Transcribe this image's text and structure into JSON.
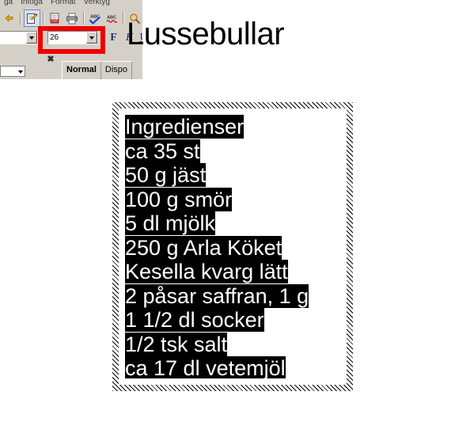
{
  "app": {
    "menu": {
      "items": [
        {
          "label": "ga"
        },
        {
          "label": "Infoga"
        },
        {
          "label": "Format"
        },
        {
          "label": "Verktyg"
        }
      ]
    },
    "toolbar_main": {
      "buttons": [
        {
          "name": "open-recent-icon",
          "label": "◆"
        },
        {
          "name": "edit-mode-icon",
          "label": "✎"
        },
        {
          "name": "export-pdf-icon",
          "label": "PDF"
        },
        {
          "name": "print-icon",
          "label": "⎙"
        },
        {
          "name": "spellcheck-icon",
          "label": "ABC"
        },
        {
          "name": "autospellcheck-icon",
          "label": "ABC"
        },
        {
          "name": "find-replace-icon",
          "label": "⌕"
        }
      ]
    },
    "toolbar_format": {
      "font_name_value": "",
      "font_size_value": "26",
      "font_size_placeholder": "26",
      "bold_label": "F",
      "italic_label": "K",
      "underline_label": "U"
    },
    "sidebar": {
      "close_label": "✖",
      "small_combo_value": ""
    },
    "view_tabs": [
      {
        "label": "Normal",
        "selected": true
      },
      {
        "label": "Dispo",
        "selected": false
      }
    ]
  },
  "annotation": {
    "color": "#ee0000",
    "target": "font-size-field"
  },
  "document": {
    "title": "Lussebullar",
    "lines": [
      "Ingredienser",
      "ca 35 st",
      "50 g jäst",
      "100 g smör",
      "5 dl mjölk",
      "250 g Arla Köket",
      "Kesella kvarg lätt",
      "2 påsar saffran, 1 g",
      "1 1/2 dl socker",
      "1/2 tsk salt",
      "ca 17 dl vetemjöl"
    ]
  }
}
